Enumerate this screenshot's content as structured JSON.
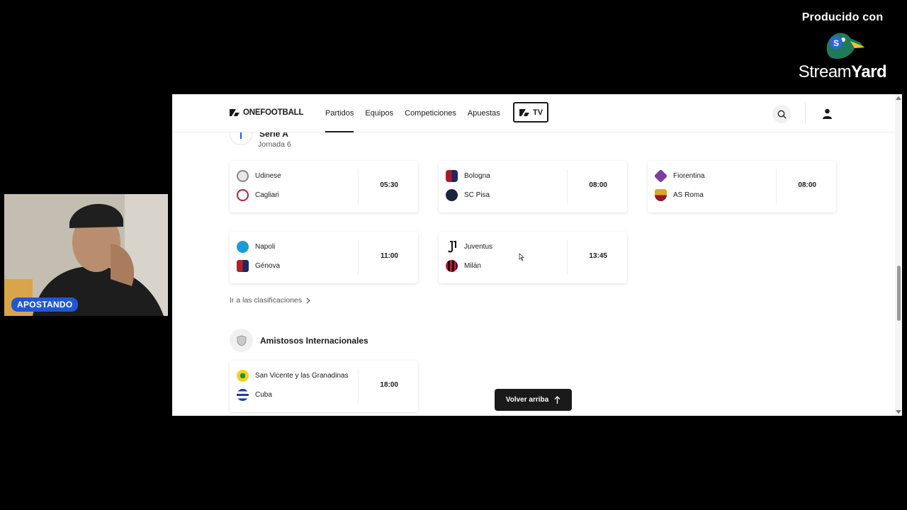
{
  "overlay": {
    "brand_top": "Producido con",
    "brand_name_light": "Stream",
    "brand_name_bold": "Yard",
    "webcam_label": "APOSTANDO"
  },
  "header": {
    "logo": "ONEFOOTBALL",
    "nav": [
      "Partidos",
      "Equipos",
      "Competiciones",
      "Apuestas"
    ],
    "active_nav": "Partidos",
    "tv_label": "TV"
  },
  "competition": {
    "title": "Serie A",
    "round": "Jornada 6",
    "matches": [
      {
        "home": "Udinese",
        "away": "Cagliari",
        "time": "05:30"
      },
      {
        "home": "Bologna",
        "away": "SC Pisa",
        "time": "08:00"
      },
      {
        "home": "Fiorentina",
        "away": "AS Roma",
        "time": "08:00"
      },
      {
        "home": "Napoli",
        "away": "Génova",
        "time": "11:00"
      },
      {
        "home": "Juventus",
        "away": "Milán",
        "time": "13:45"
      }
    ],
    "standings_link": "Ir a las clasificaciones"
  },
  "friendlies": {
    "title": "Amistosos Internacionales",
    "matches": [
      {
        "home": "San Vicente y las Granadinas",
        "away": "Cuba",
        "time": "18:00"
      }
    ]
  },
  "back_to_top": "Volver arriba",
  "colors": {
    "accent": "#1a1a1a",
    "badge": "#1f57d6"
  }
}
